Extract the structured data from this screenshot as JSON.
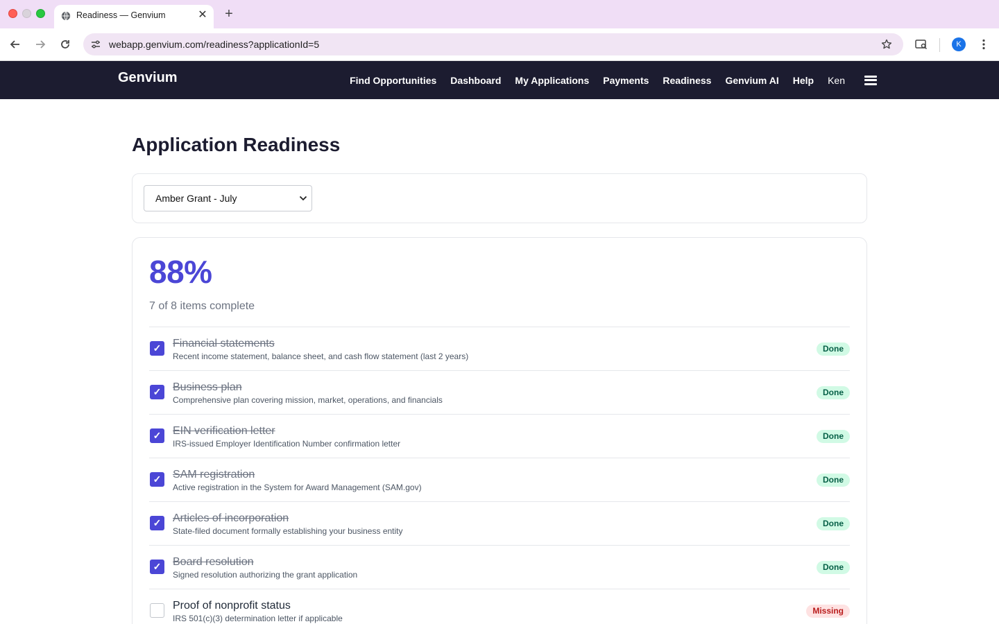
{
  "browser": {
    "tab_title": "Readiness — Genvium",
    "url": "webapp.genvium.com/readiness?applicationId=5",
    "profile_initial": "K"
  },
  "nav": {
    "brand": "Genvium",
    "links": [
      "Find Opportunities",
      "Dashboard",
      "My Applications",
      "Payments",
      "Readiness",
      "Genvium AI",
      "Help"
    ],
    "user": "Ken"
  },
  "page": {
    "title": "Application Readiness",
    "selected_application": "Amber Grant - July"
  },
  "readiness": {
    "percent": "88%",
    "summary": "7 of 8 items complete",
    "items": [
      {
        "title": "Financial statements",
        "desc": "Recent income statement, balance sheet, and cash flow statement (last 2 years)",
        "status": "Done",
        "checked": true
      },
      {
        "title": "Business plan",
        "desc": "Comprehensive plan covering mission, market, operations, and financials",
        "status": "Done",
        "checked": true
      },
      {
        "title": "EIN verification letter",
        "desc": "IRS-issued Employer Identification Number confirmation letter",
        "status": "Done",
        "checked": true
      },
      {
        "title": "SAM registration",
        "desc": "Active registration in the System for Award Management (SAM.gov)",
        "status": "Done",
        "checked": true
      },
      {
        "title": "Articles of incorporation",
        "desc": "State-filed document formally establishing your business entity",
        "status": "Done",
        "checked": true
      },
      {
        "title": "Board resolution",
        "desc": "Signed resolution authorizing the grant application",
        "status": "Done",
        "checked": true
      },
      {
        "title": "Proof of nonprofit status",
        "desc": "IRS 501(c)(3) determination letter if applicable",
        "status": "Missing",
        "checked": false
      }
    ],
    "check_glyph": "✓"
  },
  "colors": {
    "accent": "#4b46d6",
    "nav_bg": "#1c1c30",
    "done_badge_bg": "#d1fae5",
    "missing_badge_bg": "#fee2e2"
  }
}
